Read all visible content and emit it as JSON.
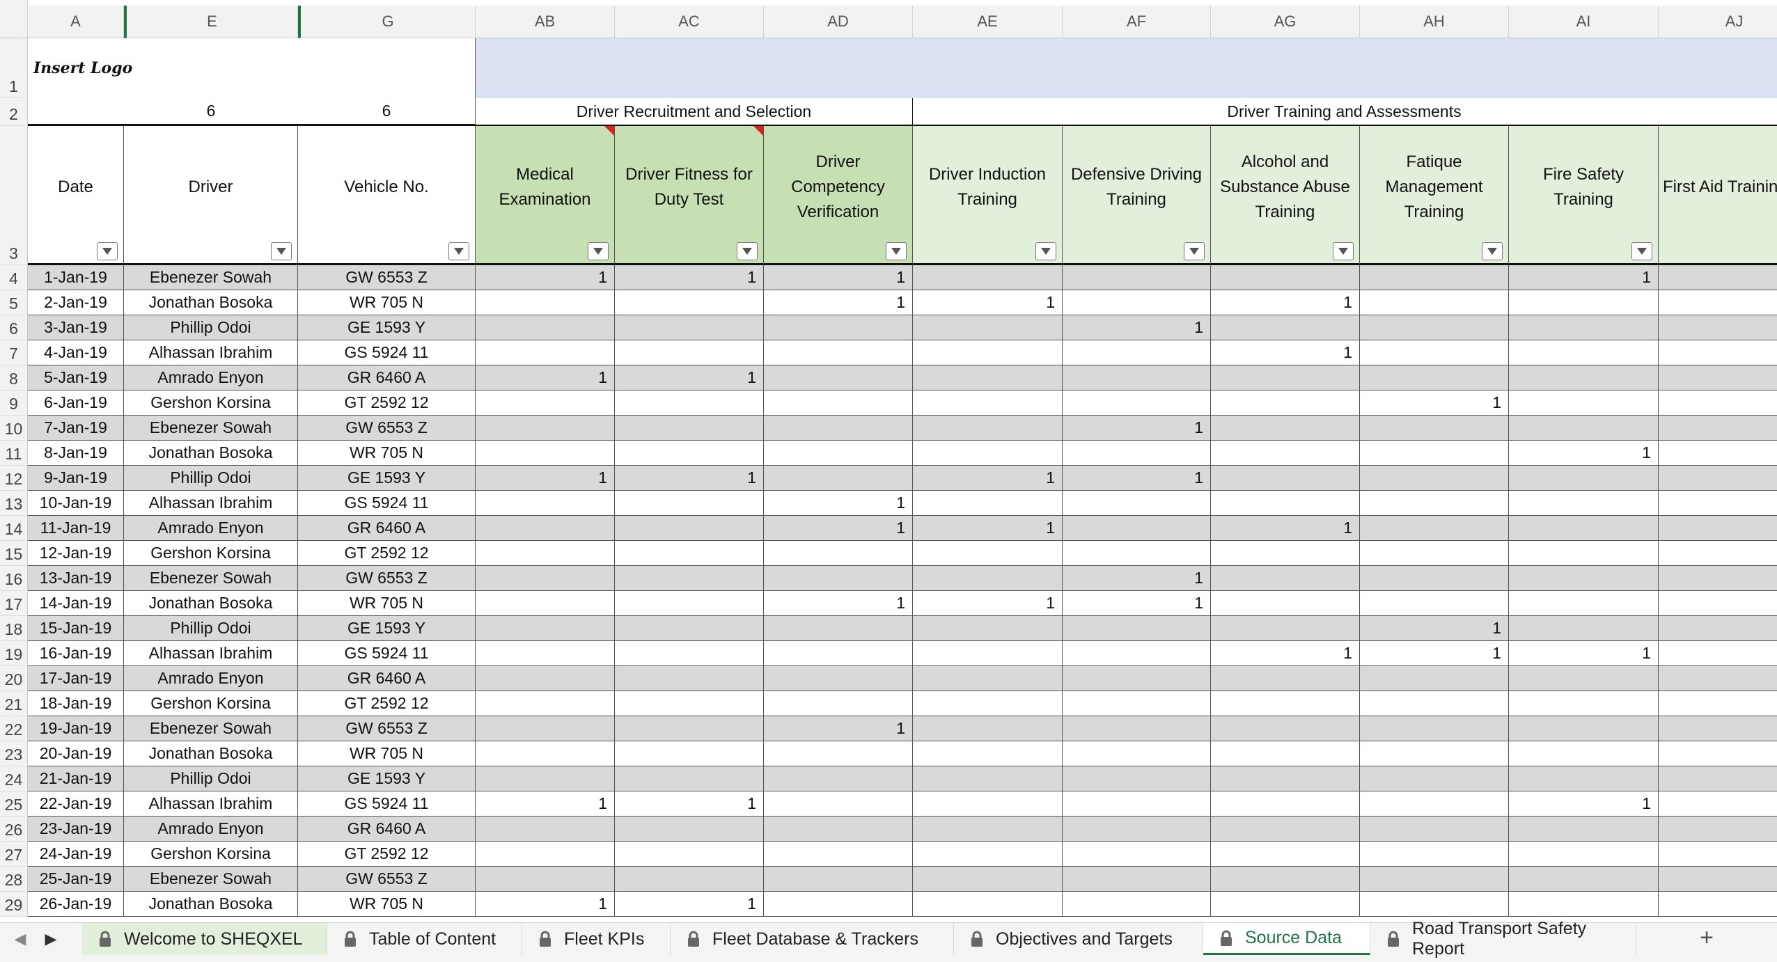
{
  "columns": [
    "A",
    "E",
    "G",
    "AB",
    "AC",
    "AD",
    "AE",
    "AF",
    "AG",
    "AH",
    "AI",
    "AJ"
  ],
  "row1": {
    "logo": "Insert Logo"
  },
  "row2": {
    "driver_count": "6",
    "vehicle_count": "6",
    "group1": "Driver Recruitment and Selection",
    "group2": "Driver Training and Assessments"
  },
  "headers": [
    "Date",
    "Driver",
    "Vehicle No.",
    "Medical Examination",
    "Driver Fitness for Duty Test",
    "Driver Competency Verification",
    "Driver Induction Training",
    "Defensive Driving Training",
    "Alcohol and Substance Abuse Training",
    "Fatique Management Training",
    "Fire Safety Training",
    "First Aid Training"
  ],
  "rows": [
    {
      "r": "4",
      "date": "1-Jan-19",
      "driver": "Ebenezer Sowah",
      "vehicle": "GW 6553 Z",
      "v": [
        "1",
        "1",
        "1",
        "",
        "",
        "",
        "",
        "1",
        ""
      ]
    },
    {
      "r": "5",
      "date": "2-Jan-19",
      "driver": "Jonathan Bosoka",
      "vehicle": "WR 705 N",
      "v": [
        "",
        "",
        "1",
        "1",
        "",
        "1",
        "",
        "",
        ""
      ]
    },
    {
      "r": "6",
      "date": "3-Jan-19",
      "driver": "Phillip Odoi",
      "vehicle": "GE 1593 Y",
      "v": [
        "",
        "",
        "",
        "",
        "1",
        "",
        "",
        "",
        ""
      ]
    },
    {
      "r": "7",
      "date": "4-Jan-19",
      "driver": "Alhassan Ibrahim",
      "vehicle": "GS 5924 11",
      "v": [
        "",
        "",
        "",
        "",
        "",
        "1",
        "",
        "",
        ""
      ]
    },
    {
      "r": "8",
      "date": "5-Jan-19",
      "driver": "Amrado Enyon",
      "vehicle": "GR 6460 A",
      "v": [
        "1",
        "1",
        "",
        "",
        "",
        "",
        "",
        "",
        ""
      ]
    },
    {
      "r": "9",
      "date": "6-Jan-19",
      "driver": "Gershon Korsina",
      "vehicle": "GT 2592 12",
      "v": [
        "",
        "",
        "",
        "",
        "",
        "",
        "1",
        "",
        ""
      ]
    },
    {
      "r": "10",
      "date": "7-Jan-19",
      "driver": "Ebenezer Sowah",
      "vehicle": "GW 6553 Z",
      "v": [
        "",
        "",
        "",
        "",
        "1",
        "",
        "",
        "",
        ""
      ]
    },
    {
      "r": "11",
      "date": "8-Jan-19",
      "driver": "Jonathan Bosoka",
      "vehicle": "WR 705 N",
      "v": [
        "",
        "",
        "",
        "",
        "",
        "",
        "",
        "1",
        ""
      ]
    },
    {
      "r": "12",
      "date": "9-Jan-19",
      "driver": "Phillip Odoi",
      "vehicle": "GE 1593 Y",
      "v": [
        "1",
        "1",
        "",
        "1",
        "1",
        "",
        "",
        "",
        ""
      ]
    },
    {
      "r": "13",
      "date": "10-Jan-19",
      "driver": "Alhassan Ibrahim",
      "vehicle": "GS 5924 11",
      "v": [
        "",
        "",
        "1",
        "",
        "",
        "",
        "",
        "",
        ""
      ]
    },
    {
      "r": "14",
      "date": "11-Jan-19",
      "driver": "Amrado Enyon",
      "vehicle": "GR 6460 A",
      "v": [
        "",
        "",
        "1",
        "1",
        "",
        "1",
        "",
        "",
        ""
      ]
    },
    {
      "r": "15",
      "date": "12-Jan-19",
      "driver": "Gershon Korsina",
      "vehicle": "GT 2592 12",
      "v": [
        "",
        "",
        "",
        "",
        "",
        "",
        "",
        "",
        ""
      ]
    },
    {
      "r": "16",
      "date": "13-Jan-19",
      "driver": "Ebenezer Sowah",
      "vehicle": "GW 6553 Z",
      "v": [
        "",
        "",
        "",
        "",
        "1",
        "",
        "",
        "",
        ""
      ]
    },
    {
      "r": "17",
      "date": "14-Jan-19",
      "driver": "Jonathan Bosoka",
      "vehicle": "WR 705 N",
      "v": [
        "",
        "",
        "1",
        "1",
        "1",
        "",
        "",
        "",
        ""
      ]
    },
    {
      "r": "18",
      "date": "15-Jan-19",
      "driver": "Phillip Odoi",
      "vehicle": "GE 1593 Y",
      "v": [
        "",
        "",
        "",
        "",
        "",
        "",
        "1",
        "",
        ""
      ]
    },
    {
      "r": "19",
      "date": "16-Jan-19",
      "driver": "Alhassan Ibrahim",
      "vehicle": "GS 5924 11",
      "v": [
        "",
        "",
        "",
        "",
        "",
        "1",
        "1",
        "1",
        ""
      ]
    },
    {
      "r": "20",
      "date": "17-Jan-19",
      "driver": "Amrado Enyon",
      "vehicle": "GR 6460 A",
      "v": [
        "",
        "",
        "",
        "",
        "",
        "",
        "",
        "",
        ""
      ]
    },
    {
      "r": "21",
      "date": "18-Jan-19",
      "driver": "Gershon Korsina",
      "vehicle": "GT 2592 12",
      "v": [
        "",
        "",
        "",
        "",
        "",
        "",
        "",
        "",
        ""
      ]
    },
    {
      "r": "22",
      "date": "19-Jan-19",
      "driver": "Ebenezer Sowah",
      "vehicle": "GW 6553 Z",
      "v": [
        "",
        "",
        "1",
        "",
        "",
        "",
        "",
        "",
        ""
      ]
    },
    {
      "r": "23",
      "date": "20-Jan-19",
      "driver": "Jonathan Bosoka",
      "vehicle": "WR 705 N",
      "v": [
        "",
        "",
        "",
        "",
        "",
        "",
        "",
        "",
        ""
      ]
    },
    {
      "r": "24",
      "date": "21-Jan-19",
      "driver": "Phillip Odoi",
      "vehicle": "GE 1593 Y",
      "v": [
        "",
        "",
        "",
        "",
        "",
        "",
        "",
        "",
        ""
      ]
    },
    {
      "r": "25",
      "date": "22-Jan-19",
      "driver": "Alhassan Ibrahim",
      "vehicle": "GS 5924 11",
      "v": [
        "1",
        "1",
        "",
        "",
        "",
        "",
        "",
        "1",
        ""
      ]
    },
    {
      "r": "26",
      "date": "23-Jan-19",
      "driver": "Amrado Enyon",
      "vehicle": "GR 6460 A",
      "v": [
        "",
        "",
        "",
        "",
        "",
        "",
        "",
        "",
        ""
      ]
    },
    {
      "r": "27",
      "date": "24-Jan-19",
      "driver": "Gershon Korsina",
      "vehicle": "GT 2592 12",
      "v": [
        "",
        "",
        "",
        "",
        "",
        "",
        "",
        "",
        ""
      ]
    },
    {
      "r": "28",
      "date": "25-Jan-19",
      "driver": "Ebenezer Sowah",
      "vehicle": "GW 6553 Z",
      "v": [
        "",
        "",
        "",
        "",
        "",
        "",
        "",
        "",
        ""
      ]
    },
    {
      "r": "29",
      "date": "26-Jan-19",
      "driver": "Jonathan Bosoka",
      "vehicle": "WR 705 N",
      "v": [
        "1",
        "1",
        "",
        "",
        "",
        "",
        "",
        "",
        ""
      ]
    }
  ],
  "tabs": [
    {
      "label": "Welcome to SHEQXEL",
      "active": false
    },
    {
      "label": "Table of Content",
      "active": false
    },
    {
      "label": "Fleet KPIs",
      "active": false
    },
    {
      "label": "Fleet Database & Trackers",
      "active": false
    },
    {
      "label": "Objectives and Targets",
      "active": false
    },
    {
      "label": "Source Data",
      "active": true
    },
    {
      "label": "Road Transport Safety Report",
      "active": false
    }
  ],
  "colors": {
    "header_band": "#d9e1f2",
    "green_dark": "#c6e0b4",
    "green_light": "#e2efda",
    "row_gray": "#d9d9d9",
    "tab_active": "#217346",
    "note": "#e02020"
  }
}
